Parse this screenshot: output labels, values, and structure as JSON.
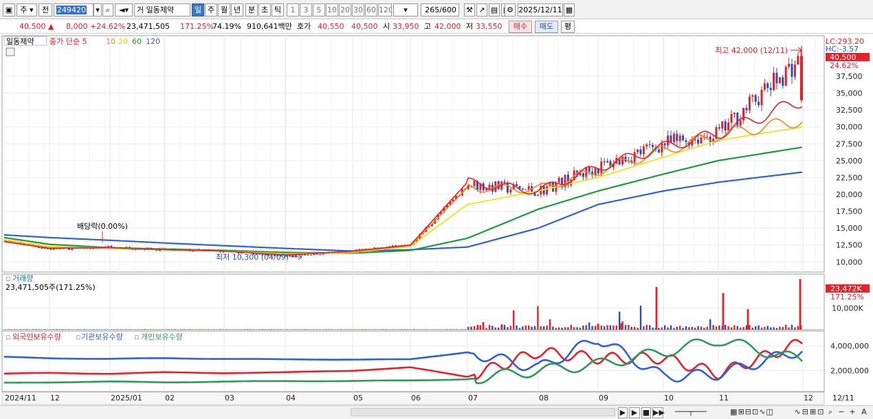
{
  "toolbar": {
    "market_label": "주",
    "all_label": "전",
    "code_value": "249420",
    "category_label": "거",
    "stock_name": "일동제약",
    "period_day": "일",
    "period_week": "주",
    "period_month": "월",
    "period_year": "년",
    "period_minute": "분",
    "period_second": "초",
    "period_tick": "틱",
    "n_buttons": [
      "1",
      "3",
      "5",
      "10",
      "20",
      "30",
      "60",
      "120"
    ],
    "count_value": "265",
    "count_max": "/600",
    "date_value": "2025/12/11"
  },
  "quote": {
    "price": "40,500",
    "arrow": "▲",
    "change": "8,000",
    "change_pct": "+24.62%",
    "volume": "23,471,505",
    "volume_ratio": "171.25%",
    "turnover": "74.19%",
    "value": "910,641백만",
    "hoga_label": "호가",
    "ask": "40,550",
    "bid": "40,500",
    "open_label": "시",
    "open": "33,950",
    "high_label": "고",
    "high": "42,000",
    "low_label": "저",
    "low": "33,550",
    "buy_label": "매수",
    "sell_label": "매도",
    "eval_label": "평"
  },
  "price_panel": {
    "name_tag": "일동제약",
    "ma_prefix": "종가 단순",
    "ma_periods": [
      "5",
      "10",
      "20",
      "60",
      "120"
    ],
    "lc_label": "LC:293.20",
    "hc_label": "HC:-3.57",
    "last_price_tag": "40,500",
    "last_pct_tag": "24.62%",
    "high_annotation": "최고 42,000 (12/11)",
    "low_annotation": "최저 10,300 (04/09)",
    "dividend_annotation": "배당락(0.00%)"
  },
  "volume_panel": {
    "title": "거래량",
    "value_text": "23,471,505주(171.25%)",
    "last_tag": "23,472K",
    "pct_tag": "171.25%"
  },
  "holding_panel": {
    "legend": [
      "외국인보유수량",
      "기관보유수량",
      "개인보유수량"
    ]
  },
  "x_axis": {
    "labels": [
      "2024/11",
      "12",
      "2025/01",
      "02",
      "03",
      "04",
      "05",
      "06",
      "07",
      "08",
      "09",
      "10",
      "11",
      "12"
    ],
    "right_label": "12/11"
  },
  "colors": {
    "up": "#e8202a",
    "down": "#2350c8",
    "ma5": "#e8202a",
    "ma10": "#f08a1c",
    "ma20": "#f2e21a",
    "ma60": "#1f9a3a",
    "ma120": "#2f5fe0",
    "foreign": "#e8202a",
    "institution": "#2f5fe0",
    "individual": "#2e9a5a"
  },
  "chart_data": {
    "type": "line",
    "x": [
      "2024-11",
      "2024-12",
      "2025-01",
      "2025-02",
      "2025-03",
      "2025-04",
      "2025-05",
      "2025-06",
      "2025-07",
      "2025-08",
      "2025-09",
      "2025-10",
      "2025-11",
      "2025-12-11"
    ],
    "y_ticks": [
      10000,
      12500,
      15000,
      17500,
      20000,
      22500,
      25000,
      27500,
      30000,
      32500,
      35000,
      37500
    ],
    "ylim": [
      8500,
      43500
    ],
    "series": [
      {
        "name": "종가",
        "values": [
          13200,
          11900,
          12200,
          11800,
          11600,
          10900,
          11600,
          12500,
          21500,
          20500,
          24000,
          27500,
          29000,
          40500
        ]
      },
      {
        "name": "5",
        "values": [
          13000,
          12000,
          12100,
          11800,
          11600,
          11000,
          11600,
          12500,
          21800,
          20500,
          24000,
          27000,
          29000,
          34000
        ]
      },
      {
        "name": "10",
        "values": [
          13100,
          12100,
          12100,
          11800,
          11600,
          11100,
          11500,
          12400,
          21000,
          20800,
          23500,
          26500,
          28800,
          31000
        ]
      },
      {
        "name": "20",
        "values": [
          13300,
          12300,
          12000,
          11800,
          11600,
          11200,
          11400,
          12300,
          18500,
          20500,
          22500,
          25500,
          28000,
          30000
        ]
      },
      {
        "name": "60",
        "values": [
          13600,
          12600,
          12100,
          11900,
          11700,
          11400,
          11300,
          11700,
          13500,
          17800,
          20500,
          23000,
          25000,
          27000
        ]
      },
      {
        "name": "120",
        "values": [
          14000,
          13600,
          13200,
          12800,
          12400,
          12000,
          11600,
          11800,
          12200,
          15000,
          18500,
          20500,
          21800,
          23300
        ]
      }
    ],
    "volume_ticks": [
      10000
    ],
    "volume_unit": "K",
    "volume_last": 23472,
    "holding_ticks": [
      2000000,
      4000000
    ],
    "holding_series": [
      {
        "name": "외국인보유수량",
        "values": [
          1750000,
          1800000,
          1750000,
          1850000,
          1800000,
          1850000,
          2000000,
          2250000,
          1500000,
          3500000,
          3000000,
          3000000,
          1750000,
          4300000
        ]
      },
      {
        "name": "기관보유수량",
        "values": [
          3100000,
          3000000,
          2950000,
          3000000,
          2950000,
          2900000,
          2900000,
          2900000,
          3500000,
          2200000,
          4600000,
          1500000,
          1700000,
          3700000
        ]
      },
      {
        "name": "개인보유수량",
        "values": [
          1000000,
          1050000,
          1100000,
          1050000,
          1100000,
          1150000,
          1150000,
          1200000,
          1300000,
          2000000,
          2500000,
          3500000,
          4500000,
          2800000
        ]
      }
    ]
  }
}
